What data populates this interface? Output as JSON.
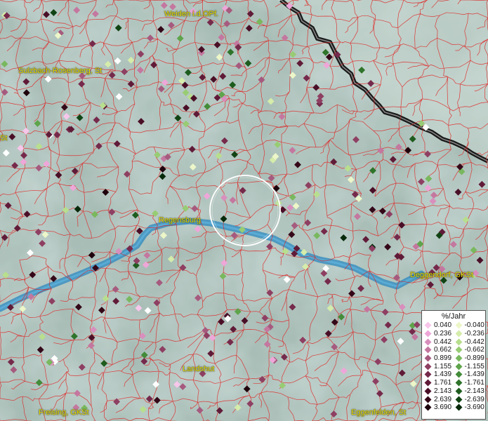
{
  "map": {
    "cities": [
      {
        "id": "weiden",
        "label": "Weiden i.d.OPf."
      },
      {
        "id": "sulzbach",
        "label": "Sulzbach-Rosenberg, St"
      },
      {
        "id": "regensburg",
        "label": "Regensburg"
      },
      {
        "id": "deggendorf",
        "label": "Deggendorf, GKSt"
      },
      {
        "id": "landshut",
        "label": "Landshut"
      },
      {
        "id": "freising",
        "label": "Freising, GKSt"
      },
      {
        "id": "eggenfelden",
        "label": "Eggenfelden, St"
      },
      {
        "id": "west-edge",
        "label": "St"
      }
    ],
    "colors": {
      "boundary": "#e02020",
      "river": "#3b8fc0",
      "border": "#1a1a1a",
      "label": "#e8e000",
      "highlight_circle": "#ffffff"
    }
  },
  "legend": {
    "title": "%/Jahr",
    "positive": [
      {
        "value": "0.040",
        "color": "#f7c6ea"
      },
      {
        "value": "0.236",
        "color": "#eea6d8"
      },
      {
        "value": "0.442",
        "color": "#d98fbd"
      },
      {
        "value": "0.662",
        "color": "#c4779f"
      },
      {
        "value": "0.899",
        "color": "#a65a7e"
      },
      {
        "value": "1.155",
        "color": "#8e3f62"
      },
      {
        "value": "1.439",
        "color": "#762a4b"
      },
      {
        "value": "1.761",
        "color": "#601b38"
      },
      {
        "value": "2.143",
        "color": "#4a0f27"
      },
      {
        "value": "2.639",
        "color": "#340818"
      },
      {
        "value": "3.690",
        "color": "#1e030c"
      }
    ],
    "negative": [
      {
        "value": "-0.040",
        "color": "#ecf6c8"
      },
      {
        "value": "-0.236",
        "color": "#d5ecaa"
      },
      {
        "value": "-0.442",
        "color": "#b8df8d"
      },
      {
        "value": "-0.662",
        "color": "#98cc74"
      },
      {
        "value": "-0.899",
        "color": "#79b85e"
      },
      {
        "value": "-1.155",
        "color": "#5ea44b"
      },
      {
        "value": "-1.439",
        "color": "#438c39"
      },
      {
        "value": "-1.761",
        "color": "#2f742b"
      },
      {
        "value": "-2.143",
        "color": "#1e5c1e"
      },
      {
        "value": "-2.639",
        "color": "#114414"
      },
      {
        "value": "-3.690",
        "color": "#062a0a"
      }
    ]
  }
}
